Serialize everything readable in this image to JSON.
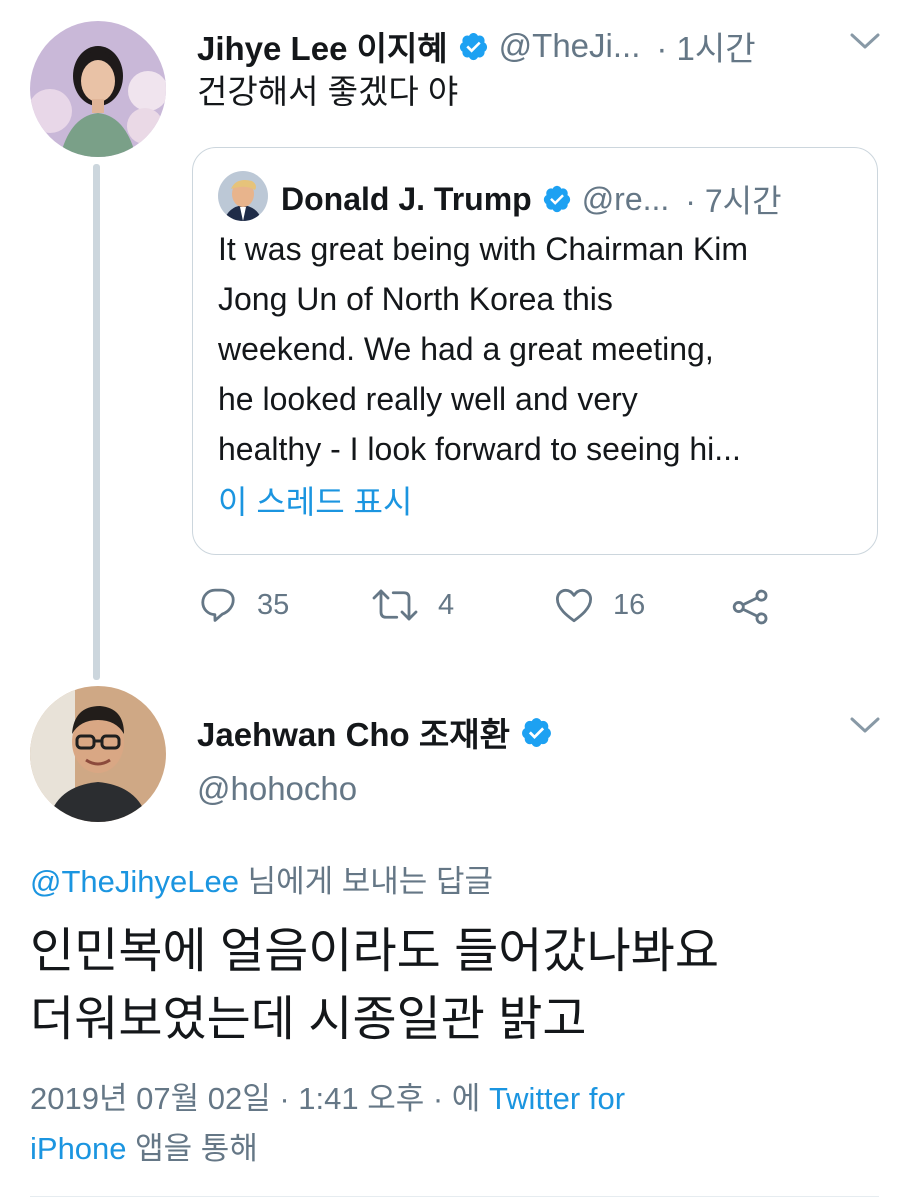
{
  "parent_tweet": {
    "name": "Jihye Lee 이지혜",
    "handle": "@TheJi...",
    "time": "· 1시간",
    "text": "건강해서 좋겠다 야",
    "actions": {
      "reply_count": "35",
      "retweet_count": "4",
      "like_count": "16"
    }
  },
  "quoted_tweet": {
    "name": "Donald J. Trump",
    "handle": "@re...",
    "time": "· 7시간",
    "text_lines": [
      "It was great being with Chairman Kim",
      "Jong Un of North Korea this",
      "weekend. We had a great meeting,",
      "he looked really well and very",
      "healthy - I look forward to seeing hi..."
    ],
    "show_thread": "이 스레드 표시"
  },
  "main_tweet": {
    "name": "Jaehwan Cho 조재환",
    "handle": "@hohocho",
    "reply_to_handle": "@TheJihyeLee",
    "reply_to_suffix": " 님에게 보내는 답글",
    "text_lines": [
      "인민복에 얼음이라도 들어갔나봐요",
      "더워보였는데 시종일관 밝고"
    ],
    "meta_prefix": "2019년 07월 02일 · 1:41 오후 · 에 ",
    "meta_source_part1": "Twitter for",
    "meta_source_part2": "iPhone",
    "meta_suffix": " 앱을 통해"
  },
  "colors": {
    "accent": "#1da1f2",
    "link": "#1b95e0",
    "secondary_text": "#657786",
    "border": "#ccd6dd"
  },
  "icons": [
    "verified-badge-icon",
    "chevron-down-icon",
    "reply-icon",
    "retweet-icon",
    "like-icon",
    "share-icon"
  ]
}
